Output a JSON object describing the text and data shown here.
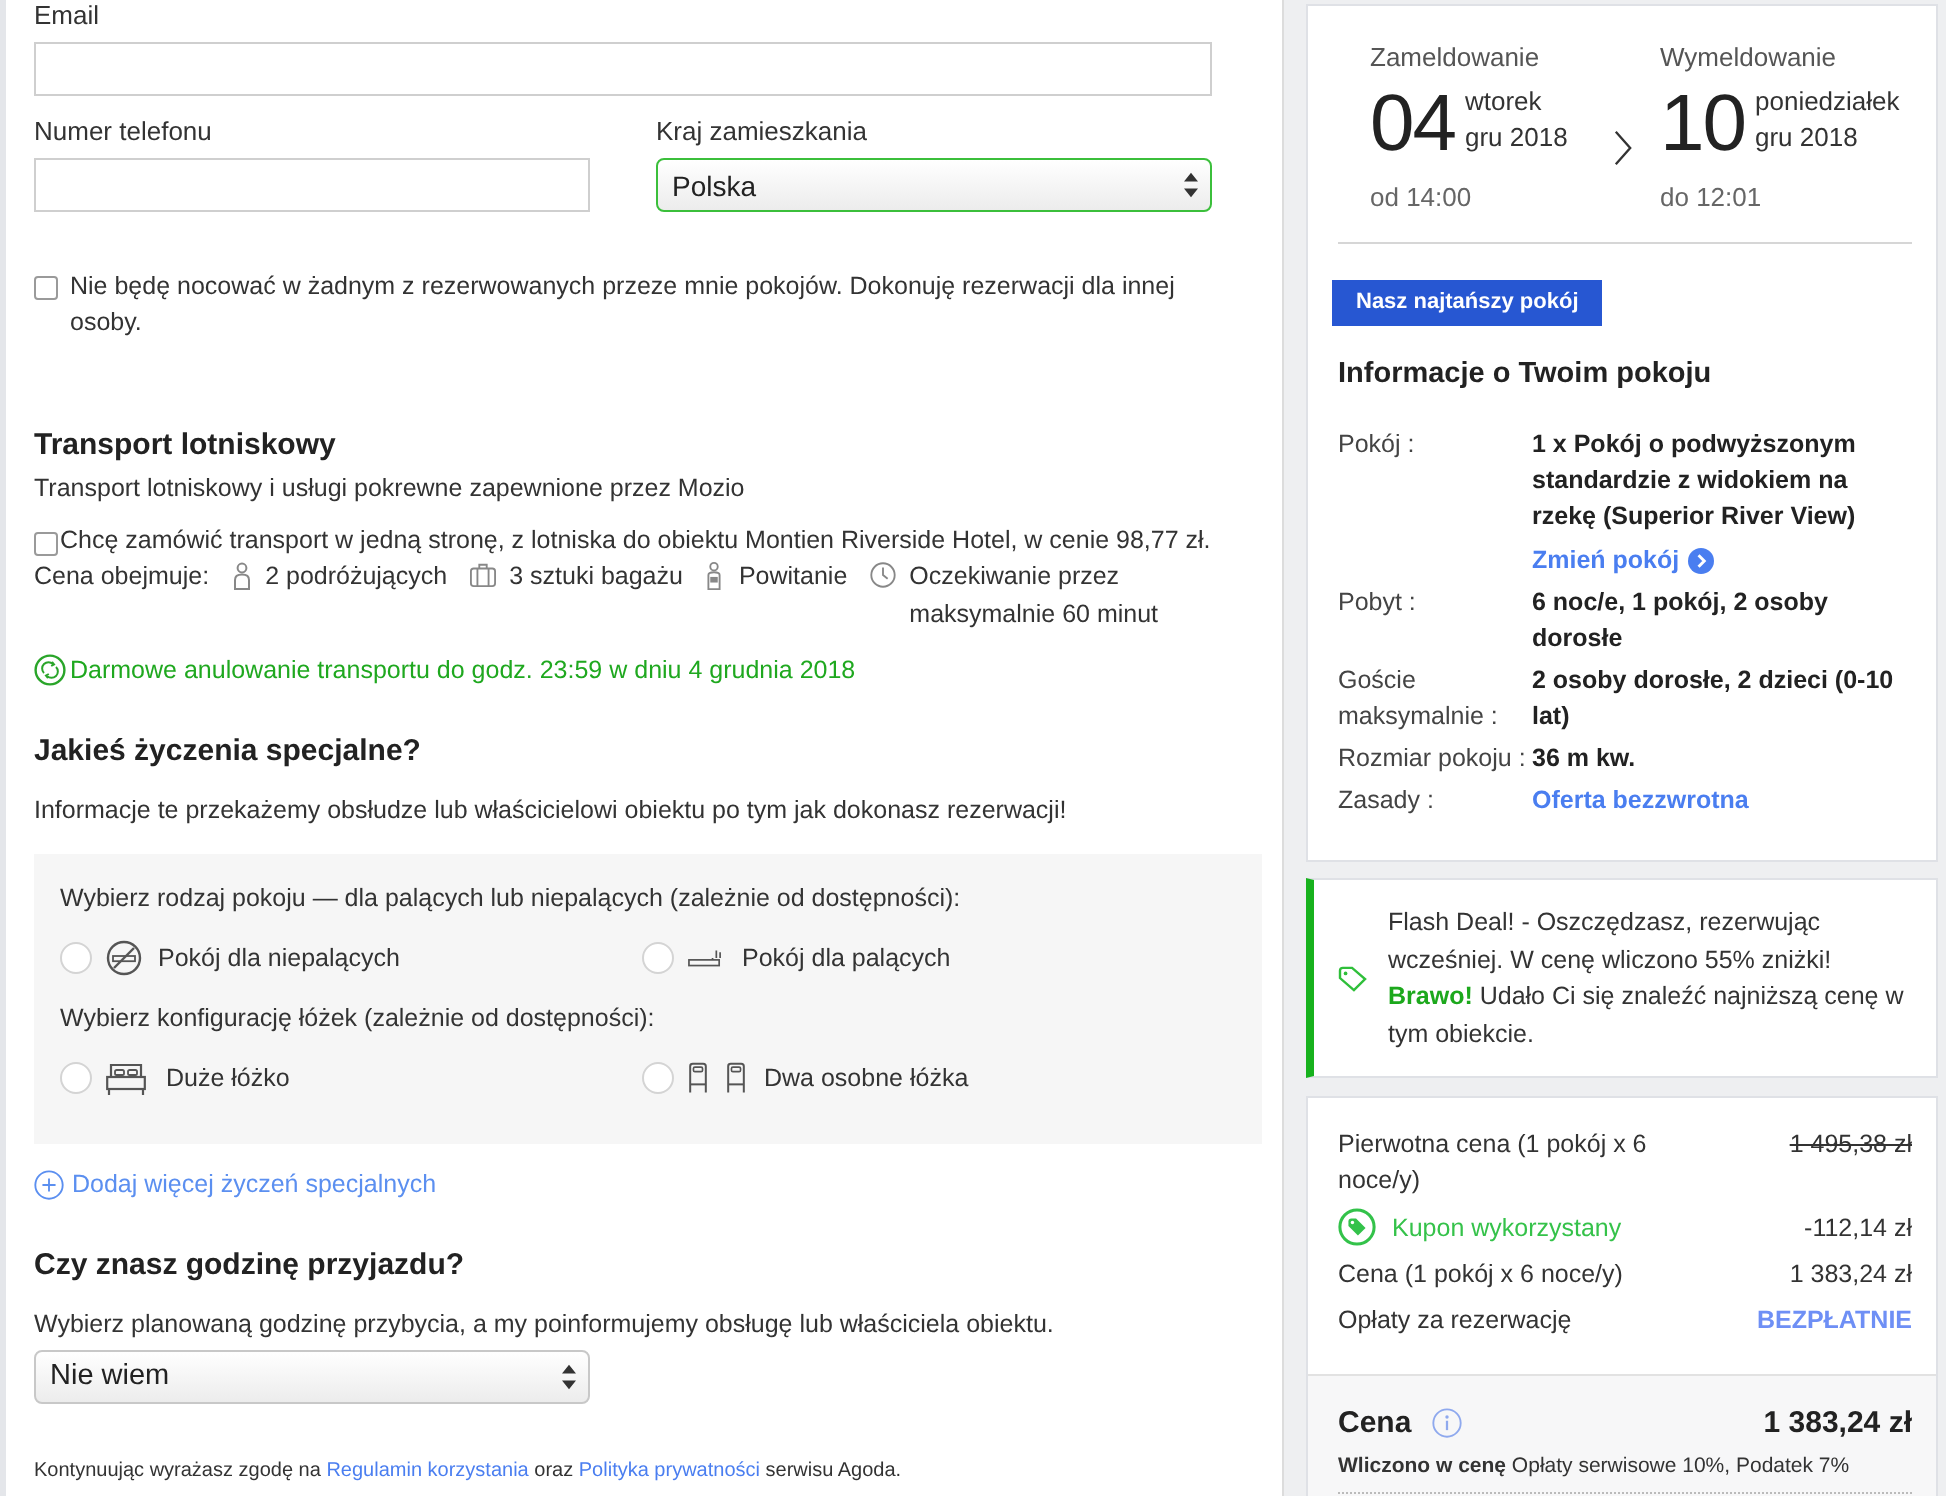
{
  "contact_form": {
    "email": {
      "label": "Email"
    },
    "phone": {
      "label": "Numer telefonu"
    },
    "country": {
      "label": "Kraj zamieszkania",
      "value": "Polska",
      "valid": true
    },
    "booking_for_other": {
      "label": "Nie będę nocować w żadnym z rezerwowanych przeze mnie pokojów. Dokonuję rezerwacji dla innej osoby.",
      "checked": false
    }
  },
  "airport_transfer": {
    "heading": "Transport lotniskowy",
    "provider": "Transport lotniskowy i usługi pokrewne zapewnione przez Mozio",
    "offer": {
      "label": "Chcę zamówić transport w jedną stronę, z lotniska do obiektu Montien Riverside Hotel, w cenie 98,77 zł.",
      "checked": false
    },
    "includes_label": "Cena obejmuje:",
    "includes": [
      {
        "kind": "travelers",
        "text": "2 podróżujących"
      },
      {
        "kind": "luggage",
        "text": "3 sztuki bagażu"
      },
      {
        "kind": "greeting",
        "text": "Powitanie"
      },
      {
        "kind": "waiting",
        "text": "Oczekiwanie przez maksymalnie 60 minut"
      }
    ],
    "free_cancellation": "Darmowe anulowanie transportu do godz. 23:59 w dniu 4 grudnia 2018"
  },
  "special_requests": {
    "heading": "Jakieś życzenia specjalne?",
    "info": "Informacje te przekażemy obsłudze lub właścicielowi obiektu po tym jak dokonasz rezerwacji!",
    "groups": [
      {
        "prompt": "Wybierz rodzaj pokoju — dla palących lub niepalących (zależnie od dostępności):",
        "options": [
          {
            "kind": "non_smoking",
            "label": "Pokój dla niepalących",
            "selected": false
          },
          {
            "kind": "smoking",
            "label": "Pokój dla palących",
            "selected": false
          }
        ]
      },
      {
        "prompt": "Wybierz konfigurację łóżek (zależnie od dostępności):",
        "options": [
          {
            "kind": "large_bed",
            "label": "Duże łóżko",
            "selected": false
          },
          {
            "kind": "twin_beds",
            "label": "Dwa osobne łóżka",
            "selected": false
          }
        ]
      }
    ],
    "add_more": "Dodaj więcej życzeń specjalnych"
  },
  "arrival": {
    "heading": "Czy znasz godzinę przyjazdu?",
    "text": "Wybierz planowaną godzinę przybycia, a my poinformujemy obsługę lub właściciela obiektu.",
    "select": {
      "value": "Nie wiem"
    }
  },
  "consent": {
    "segments": [
      {
        "kind": "text",
        "text": "Kontynuując wyrażasz zgodę na"
      },
      {
        "kind": "link",
        "text": "Regulamin korzystania"
      },
      {
        "kind": "text",
        "text": "oraz"
      },
      {
        "kind": "link",
        "text": "Polityka prywatności"
      },
      {
        "kind": "text",
        "text": "serwisu Agoda."
      }
    ]
  },
  "stay": {
    "check_in": {
      "label": "Zameldowanie",
      "day": "04",
      "weekday": "wtorek",
      "month": "gru 2018",
      "time": "od 14:00"
    },
    "check_out": {
      "label": "Wymeldowanie",
      "day": "10",
      "weekday": "poniedziałek",
      "month": "gru 2018",
      "time": "do 12:01"
    }
  },
  "room_info": {
    "badge": "Nasz najtańszy pokój",
    "heading": "Informacje o Twoim pokoju",
    "rows": [
      {
        "label": "Pokój :",
        "kind": "text",
        "value": "1 x Pokój o podwyższonym standardzie z widokiem na rzekę (Superior River View)",
        "link": "Zmień pokój"
      },
      {
        "label": "Pobyt :",
        "kind": "text",
        "value": "6 noc/e, 1 pokój, 2 osoby dorosłe"
      },
      {
        "label": "Goście maksymalnie :",
        "kind": "text",
        "value": "2 osoby dorosłe, 2 dzieci (0-10 lat)"
      },
      {
        "label": "Rozmiar pokoju :",
        "kind": "text",
        "value": "36 m kw."
      },
      {
        "label": "Zasady :",
        "kind": "link",
        "value": "Oferta bezzwrotna"
      }
    ]
  },
  "deal": {
    "text": "Flash Deal! - Oszczędzasz, rezerwując wcześniej. W cenę wliczono 55% zniżki! **Brawo!** Udało Ci się znaleźć najniższą cenę w tym obiekcie."
  },
  "price_summary": {
    "rows": [
      {
        "kind": "original",
        "label": "Pierwotna cena (1 pokój x 6 noce/y)",
        "value": "1 495,38 zł"
      },
      {
        "kind": "coupon",
        "label": "Kupon wykorzystany",
        "value": "-112,14 zł"
      },
      {
        "kind": "price",
        "label": "Cena (1 pokój x 6 noce/y)",
        "value": "1 383,24 zł"
      },
      {
        "kind": "fee",
        "label": "Opłaty za rezerwację",
        "value": "BEZPŁATNIE"
      }
    ],
    "total": {
      "label": "Cena",
      "value": "1 383,24 zł",
      "included": "**Wliczono w cenę** Opłaty serwisowe 10%, Podatek 7%"
    }
  }
}
